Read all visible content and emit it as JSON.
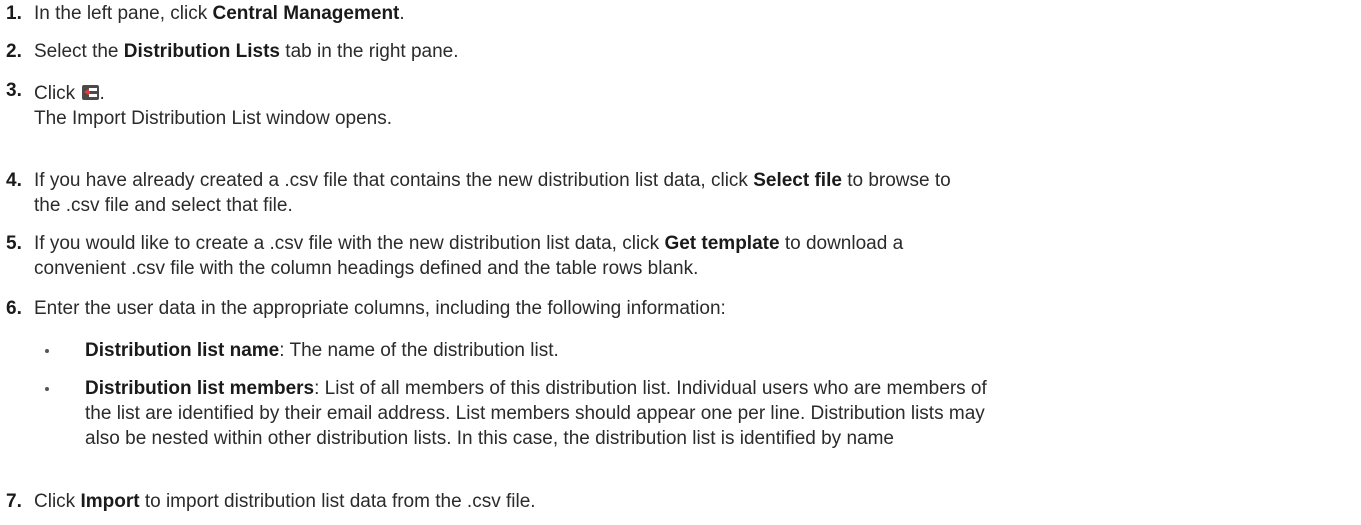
{
  "steps": [
    {
      "num": "1.",
      "parts": [
        {
          "t": "In the left pane, click "
        },
        {
          "b": "Central Management"
        },
        {
          "t": "."
        }
      ]
    },
    {
      "num": "2.",
      "parts": [
        {
          "t": "Select the "
        },
        {
          "b": "Distribution Lists"
        },
        {
          "t": " tab in the right pane."
        }
      ]
    },
    {
      "num": "3.",
      "click": "Click ",
      "after_icon": ".",
      "icon": "import-distribution-list-icon",
      "result": "The Import Distribution List window opens."
    },
    {
      "num": "4.",
      "line1": [
        {
          "t": "If you have already created a .csv file that contains the new distribution list data, click "
        },
        {
          "b": "Select file"
        },
        {
          "t": " to browse to"
        }
      ],
      "line2": "the .csv file and select that file."
    },
    {
      "num": "5.",
      "line1": [
        {
          "t": "If you would like to create a .csv file with the new distribution list data, click "
        },
        {
          "b": "Get template"
        },
        {
          "t": " to download a"
        }
      ],
      "line2": "convenient .csv file with the column headings defined and the table rows blank."
    },
    {
      "num": "6.",
      "parts": [
        {
          "t": "Enter the user data in the appropriate columns, including the following information:"
        }
      ]
    },
    {
      "num": "7.",
      "parts": [
        {
          "t": "Click "
        },
        {
          "b": "Import"
        },
        {
          "t": " to import distribution list data from the .csv file."
        }
      ]
    }
  ],
  "bullets": [
    {
      "term": "Distribution list name",
      "lines": [
        ": The name of the distribution list."
      ]
    },
    {
      "term": "Distribution list members",
      "lines": [
        ": List of all members of this distribution list. Individual users who are members of",
        "the list are identified by their email address. List members should appear one per line. Distribution lists may",
        "also be nested within other distribution lists. In this case, the distribution list is identified by name"
      ]
    }
  ]
}
